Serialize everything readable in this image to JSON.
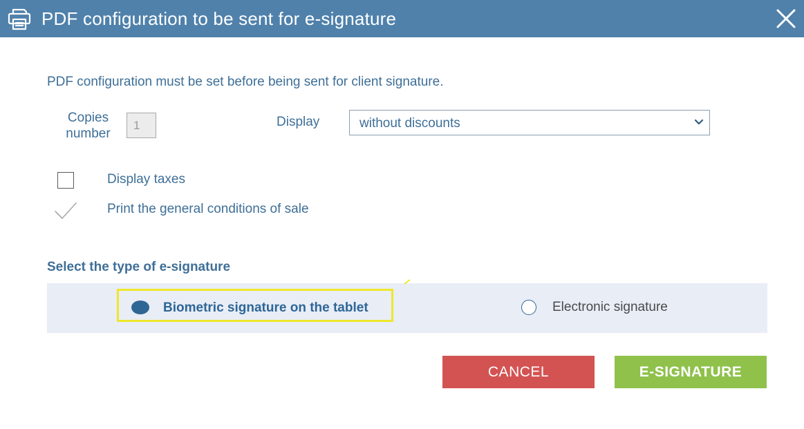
{
  "dialog": {
    "title": "PDF configuration to be sent for e-signature",
    "icons": {
      "title_icon": "printer-icon",
      "close": "close-icon"
    }
  },
  "form": {
    "intro_text": "PDF configuration must be set before being sent for client signature.",
    "copies": {
      "label_line1": "Copies",
      "label_line2": "number",
      "value": "1"
    },
    "display": {
      "label": "Display",
      "selected": "without discounts"
    },
    "options": [
      {
        "label": "Display taxes",
        "checked": false
      },
      {
        "label": "Print the general conditions of sale",
        "checked": true
      }
    ]
  },
  "signature": {
    "heading": "Select the type of e-signature",
    "options": [
      {
        "label": "Biometric signature on the tablet",
        "selected": true
      },
      {
        "label": "Electronic signature",
        "selected": false
      }
    ]
  },
  "buttons": {
    "cancel": "CANCEL",
    "esign": "E-SIGNATURE"
  },
  "colors": {
    "titlebar": "#4f81ab",
    "text": "#3e6f97",
    "panel": "#e8edf6",
    "highlight": "#f0e72a",
    "cancel": "#d35352",
    "esign": "#8fc14b"
  }
}
